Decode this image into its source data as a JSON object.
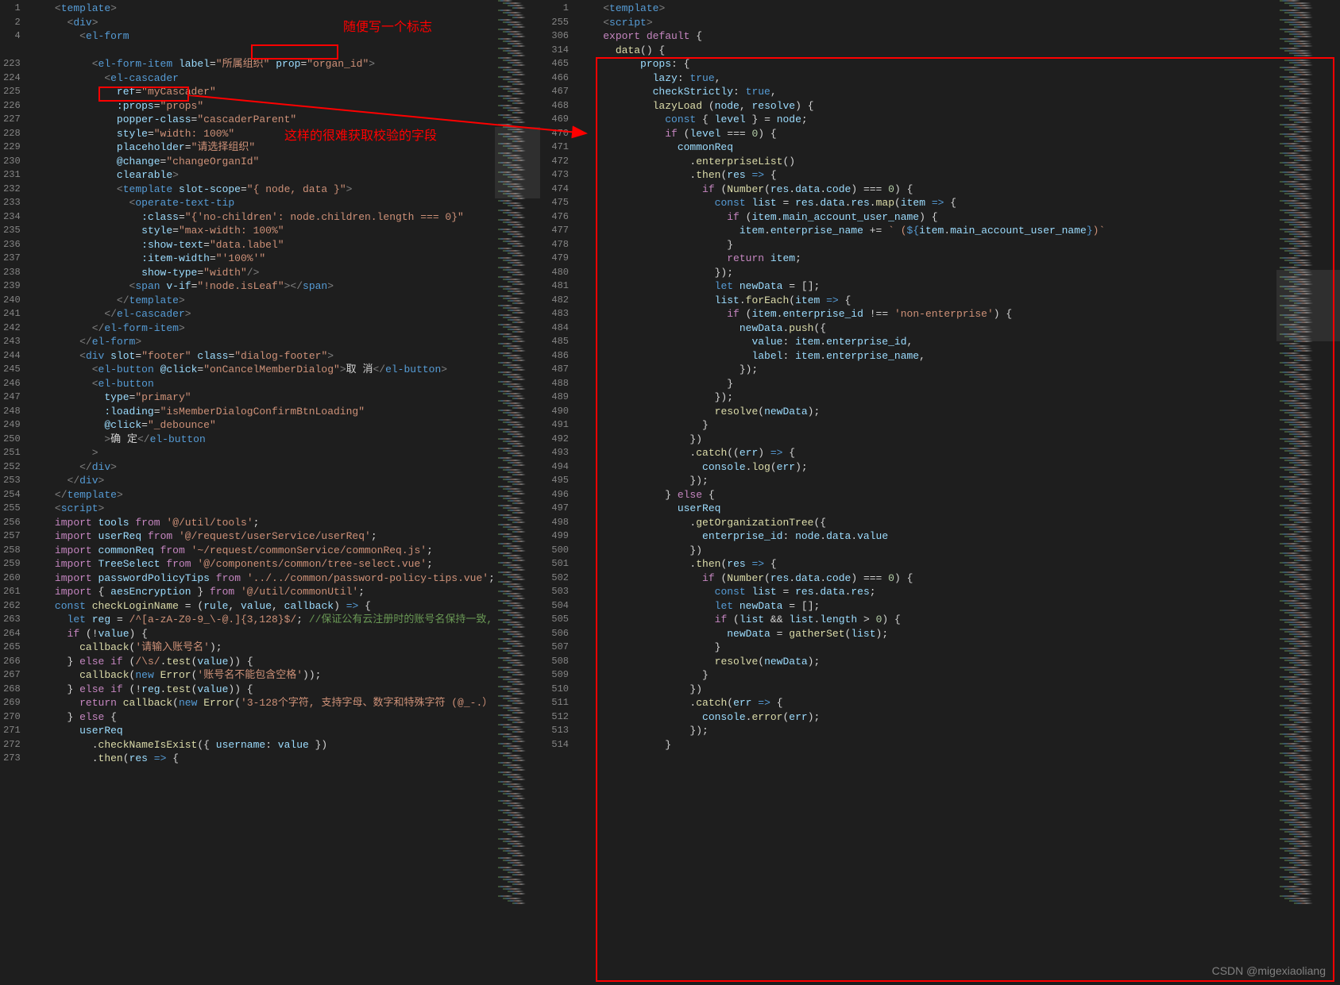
{
  "watermark": "CSDN @migexiaoliang",
  "annotations": {
    "text1": "随便写一个标志",
    "text2": "这样的很难获取校验的字段"
  },
  "left": {
    "lines": [
      {
        "n": "1",
        "html": "<span class='t-punc'>&lt;</span><span class='t-tag'>template</span><span class='t-punc'>&gt;</span>",
        "ind": 2
      },
      {
        "n": "2",
        "html": "<span class='t-punc'>&lt;</span><span class='t-tag'>div</span><span class='t-punc'>&gt;</span>",
        "ind": 3
      },
      {
        "n": "4",
        "html": "<span class='t-punc'>&lt;</span><span class='t-tag'>el-form</span>",
        "ind": 4
      },
      {
        "n": "",
        "html": "",
        "ind": 0
      },
      {
        "n": "223",
        "html": "<span class='t-punc'>&lt;</span><span class='t-tag'>el-form-item</span> <span class='t-attr'>label</span>=<span class='t-str'>\"所属组织\"</span> <span class='t-attr'>prop</span>=<span class='t-str'>\"organ_id\"</span><span class='t-punc'>&gt;</span>",
        "ind": 5
      },
      {
        "n": "224",
        "html": "<span class='t-punc'>&lt;</span><span class='t-tag'>el-cascader</span>",
        "ind": 6
      },
      {
        "n": "225",
        "html": "<span class='t-attr'>ref</span>=<span class='t-str'>\"myCascader\"</span>",
        "ind": 7
      },
      {
        "n": "226",
        "html": "<span class='t-attr'>:props</span>=<span class='t-str'>\"props\"</span>",
        "ind": 7
      },
      {
        "n": "227",
        "html": "<span class='t-attr'>popper-class</span>=<span class='t-str'>\"cascaderParent\"</span>",
        "ind": 7
      },
      {
        "n": "228",
        "html": "<span class='t-attr'>style</span>=<span class='t-str'>\"width: 100%\"</span>",
        "ind": 7
      },
      {
        "n": "229",
        "html": "<span class='t-attr'>placeholder</span>=<span class='t-str'>\"请选择组织\"</span>",
        "ind": 7
      },
      {
        "n": "230",
        "html": "<span class='t-attr'>@change</span>=<span class='t-str'>\"changeOrganId\"</span>",
        "ind": 7
      },
      {
        "n": "231",
        "html": "<span class='t-attr'>clearable</span><span class='t-punc'>&gt;</span>",
        "ind": 7
      },
      {
        "n": "232",
        "html": "<span class='t-punc'>&lt;</span><span class='t-tag'>template</span> <span class='t-attr'>slot-scope</span>=<span class='t-str'>\"{ node, data }\"</span><span class='t-punc'>&gt;</span>",
        "ind": 7
      },
      {
        "n": "233",
        "html": "<span class='t-punc'>&lt;</span><span class='t-tag'>operate-text-tip</span>",
        "ind": 8
      },
      {
        "n": "234",
        "html": "<span class='t-attr'>:class</span>=<span class='t-str'>\"{'no-children': node.children.length === 0}\"</span>",
        "ind": 9
      },
      {
        "n": "235",
        "html": "<span class='t-attr'>style</span>=<span class='t-str'>\"max-width: 100%\"</span>",
        "ind": 9
      },
      {
        "n": "236",
        "html": "<span class='t-attr'>:show-text</span>=<span class='t-str'>\"data.label\"</span>",
        "ind": 9
      },
      {
        "n": "237",
        "html": "<span class='t-attr'>:item-width</span>=<span class='t-str'>\"'100%'\"</span>",
        "ind": 9
      },
      {
        "n": "238",
        "html": "<span class='t-attr'>show-type</span>=<span class='t-str'>\"width\"</span><span class='t-punc'>/&gt;</span>",
        "ind": 9
      },
      {
        "n": "239",
        "html": "<span class='t-punc'>&lt;</span><span class='t-tag'>span</span> <span class='t-attr'>v-if</span>=<span class='t-str'>\"!node.isLeaf\"</span><span class='t-punc'>&gt;&lt;/</span><span class='t-tag'>span</span><span class='t-punc'>&gt;</span>",
        "ind": 8
      },
      {
        "n": "240",
        "html": "<span class='t-punc'>&lt;/</span><span class='t-tag'>template</span><span class='t-punc'>&gt;</span>",
        "ind": 7
      },
      {
        "n": "241",
        "html": "<span class='t-punc'>&lt;/</span><span class='t-tag'>el-cascader</span><span class='t-punc'>&gt;</span>",
        "ind": 6
      },
      {
        "n": "242",
        "html": "<span class='t-punc'>&lt;/</span><span class='t-tag'>el-form-item</span><span class='t-punc'>&gt;</span>",
        "ind": 5
      },
      {
        "n": "243",
        "html": "<span class='t-punc'>&lt;/</span><span class='t-tag'>el-form</span><span class='t-punc'>&gt;</span>",
        "ind": 4
      },
      {
        "n": "244",
        "html": "<span class='t-punc'>&lt;</span><span class='t-tag'>div</span> <span class='t-attr'>slot</span>=<span class='t-str'>\"footer\"</span> <span class='t-attr'>class</span>=<span class='t-str'>\"dialog-footer\"</span><span class='t-punc'>&gt;</span>",
        "ind": 4
      },
      {
        "n": "245",
        "html": "<span class='t-punc'>&lt;</span><span class='t-tag'>el-button</span> <span class='t-attr'>@click</span>=<span class='t-str'>\"onCancelMemberDialog\"</span><span class='t-punc'>&gt;</span><span class='t-txt'>取 消</span><span class='t-punc'>&lt;/</span><span class='t-tag'>el-button</span><span class='t-punc'>&gt;</span>",
        "ind": 5
      },
      {
        "n": "246",
        "html": "<span class='t-punc'>&lt;</span><span class='t-tag'>el-button</span>",
        "ind": 5
      },
      {
        "n": "247",
        "html": "<span class='t-attr'>type</span>=<span class='t-str'>\"primary\"</span>",
        "ind": 6
      },
      {
        "n": "248",
        "html": "<span class='t-attr'>:loading</span>=<span class='t-str'>\"isMemberDialogConfirmBtnLoading\"</span>",
        "ind": 6
      },
      {
        "n": "249",
        "html": "<span class='t-attr'>@click</span>=<span class='t-str'>\"_debounce\"</span>",
        "ind": 6
      },
      {
        "n": "250",
        "html": "<span class='t-punc'>&gt;</span><span class='t-txt'>确 定</span><span class='t-punc'>&lt;/</span><span class='t-tag'>el-button</span>",
        "ind": 6
      },
      {
        "n": "251",
        "html": "<span class='t-punc'>&gt;</span>",
        "ind": 5
      },
      {
        "n": "252",
        "html": "<span class='t-punc'>&lt;/</span><span class='t-tag'>div</span><span class='t-punc'>&gt;</span>",
        "ind": 4
      },
      {
        "n": "253",
        "html": "<span class='t-punc'>&lt;/</span><span class='t-tag'>div</span><span class='t-punc'>&gt;</span>",
        "ind": 3
      },
      {
        "n": "254",
        "html": "<span class='t-punc'>&lt;/</span><span class='t-tag'>template</span><span class='t-punc'>&gt;</span>",
        "ind": 2
      },
      {
        "n": "255",
        "html": "<span class='t-punc'>&lt;</span><span class='t-tag'>script</span><span class='t-punc'>&gt;</span>",
        "ind": 2
      },
      {
        "n": "256",
        "html": "<span class='t-kw2'>import</span> <span class='t-var'>tools</span> <span class='t-kw2'>from</span> <span class='t-str'>'@/util/tools'</span>;",
        "ind": 2
      },
      {
        "n": "257",
        "html": "<span class='t-kw2'>import</span> <span class='t-var'>userReq</span> <span class='t-kw2'>from</span> <span class='t-str'>'@/request/userService/userReq'</span>;",
        "ind": 2
      },
      {
        "n": "258",
        "html": "<span class='t-kw2'>import</span> <span class='t-var'>commonReq</span> <span class='t-kw2'>from</span> <span class='t-str'>'~/request/commonService/commonReq.js'</span>;",
        "ind": 2
      },
      {
        "n": "259",
        "html": "<span class='t-kw2'>import</span> <span class='t-var'>TreeSelect</span> <span class='t-kw2'>from</span> <span class='t-str'>'@/components/common/tree-select.vue'</span>;",
        "ind": 2
      },
      {
        "n": "260",
        "html": "<span class='t-kw2'>import</span> <span class='t-var'>passwordPolicyTips</span> <span class='t-kw2'>from</span> <span class='t-str'>'../../common/password-policy-tips.vue'</span>;",
        "ind": 2
      },
      {
        "n": "261",
        "html": "<span class='t-kw2'>import</span> { <span class='t-var'>aesEncryption</span> } <span class='t-kw2'>from</span> <span class='t-str'>'@/util/commonUtil'</span>;",
        "ind": 2
      },
      {
        "n": "262",
        "html": "<span class='t-kw'>const</span> <span class='t-fn'>checkLoginName</span> <span class='t-op'>=</span> (<span class='t-var'>rule</span>, <span class='t-var'>value</span>, <span class='t-var'>callback</span>) <span class='t-kw'>=&gt;</span> {",
        "ind": 2
      },
      {
        "n": "263",
        "html": "<span class='t-kw'>let</span> <span class='t-var'>reg</span> <span class='t-op'>=</span> <span class='t-str'>/^[a-zA-Z0-9_\\-@.]{3,128}$/</span>; <span class='t-comm'>//保证公有云注册时的账号名保持一致,</span>",
        "ind": 3
      },
      {
        "n": "264",
        "html": "<span class='t-kw2'>if</span> (!<span class='t-var'>value</span>) {",
        "ind": 3
      },
      {
        "n": "265",
        "html": "<span class='t-fn'>callback</span>(<span class='t-str'>'请输入账号名'</span>);",
        "ind": 4
      },
      {
        "n": "266",
        "html": "} <span class='t-kw2'>else if</span> (<span class='t-str'>/\\s/</span>.<span class='t-fn'>test</span>(<span class='t-var'>value</span>)) {",
        "ind": 3
      },
      {
        "n": "267",
        "html": "<span class='t-fn'>callback</span>(<span class='t-kw'>new</span> <span class='t-fn'>Error</span>(<span class='t-str'>'账号名不能包含空格'</span>));",
        "ind": 4
      },
      {
        "n": "268",
        "html": "} <span class='t-kw2'>else if</span> (!<span class='t-var'>reg</span>.<span class='t-fn'>test</span>(<span class='t-var'>value</span>)) {",
        "ind": 3
      },
      {
        "n": "269",
        "html": "<span class='t-kw2'>return</span> <span class='t-fn'>callback</span>(<span class='t-kw'>new</span> <span class='t-fn'>Error</span>(<span class='t-str'>'3-128个字符, 支持字母、数字和特殊字符 (@_-.）</span>",
        "ind": 4
      },
      {
        "n": "270",
        "html": "} <span class='t-kw2'>else</span> {",
        "ind": 3
      },
      {
        "n": "271",
        "html": "<span class='t-var'>userReq</span>",
        "ind": 4
      },
      {
        "n": "272",
        "html": ".<span class='t-fn'>checkNameIsExist</span>({ <span class='t-var'>username</span>: <span class='t-var'>value</span> })",
        "ind": 5
      },
      {
        "n": "273",
        "html": ".<span class='t-fn'>then</span>(<span class='t-var'>res</span> <span class='t-kw'>=&gt;</span> {",
        "ind": 5
      }
    ]
  },
  "right": {
    "lines": [
      {
        "n": "1",
        "html": "<span class='t-punc'>&lt;</span><span class='t-tag'>template</span><span class='t-punc'>&gt;</span>",
        "ind": 2
      },
      {
        "n": "255",
        "html": "<span class='t-punc'>&lt;</span><span class='t-tag'>script</span><span class='t-punc'>&gt;</span>",
        "ind": 2
      },
      {
        "n": "306",
        "html": "<span class='t-kw2'>export</span> <span class='t-kw2'>default</span> {",
        "ind": 2
      },
      {
        "n": "314",
        "html": "<span class='t-fn'>data</span>() {",
        "ind": 3
      },
      {
        "n": "465",
        "html": "<span class='t-var'>props</span>: {",
        "ind": 5
      },
      {
        "n": "466",
        "html": "<span class='t-var'>lazy</span>: <span class='t-kw'>true</span>,",
        "ind": 6
      },
      {
        "n": "467",
        "html": "<span class='t-var'>checkStrictly</span>: <span class='t-kw'>true</span>,",
        "ind": 6
      },
      {
        "n": "468",
        "html": "<span class='t-fn'>lazyLoad</span> (<span class='t-var'>node</span>, <span class='t-var'>resolve</span>) {",
        "ind": 6
      },
      {
        "n": "469",
        "html": "<span class='t-kw'>const</span> { <span class='t-var'>level</span> } <span class='t-op'>=</span> <span class='t-var'>node</span>;",
        "ind": 7
      },
      {
        "n": "470",
        "html": "<span class='t-kw2'>if</span> (<span class='t-var'>level</span> <span class='t-op'>===</span> <span class='t-num'>0</span>) {",
        "ind": 7
      },
      {
        "n": "471",
        "html": "<span class='t-var'>commonReq</span>",
        "ind": 8
      },
      {
        "n": "472",
        "html": ".<span class='t-fn'>enterpriseList</span>()",
        "ind": 9
      },
      {
        "n": "473",
        "html": ".<span class='t-fn'>then</span>(<span class='t-var'>res</span> <span class='t-kw'>=&gt;</span> {",
        "ind": 9
      },
      {
        "n": "474",
        "html": "<span class='t-kw2'>if</span> (<span class='t-fn'>Number</span>(<span class='t-var'>res</span>.<span class='t-var'>data</span>.<span class='t-var'>code</span>) <span class='t-op'>===</span> <span class='t-num'>0</span>) {",
        "ind": 10
      },
      {
        "n": "475",
        "html": "<span class='t-kw'>const</span> <span class='t-var'>list</span> <span class='t-op'>=</span> <span class='t-var'>res</span>.<span class='t-var'>data</span>.<span class='t-var'>res</span>.<span class='t-fn'>map</span>(<span class='t-var'>item</span> <span class='t-kw'>=&gt;</span> {",
        "ind": 11
      },
      {
        "n": "476",
        "html": "<span class='t-kw2'>if</span> (<span class='t-var'>item</span>.<span class='t-var'>main_account_user_name</span>) {",
        "ind": 12
      },
      {
        "n": "477",
        "html": "<span class='t-var'>item</span>.<span class='t-var'>enterprise_name</span> <span class='t-op'>+=</span> <span class='t-str'>` (</span><span class='t-kw'>${</span><span class='t-var'>item</span>.<span class='t-var'>main_account_user_name</span><span class='t-kw'>}</span><span class='t-str'>)`</span>",
        "ind": 13
      },
      {
        "n": "478",
        "html": "}",
        "ind": 12
      },
      {
        "n": "479",
        "html": "<span class='t-kw2'>return</span> <span class='t-var'>item</span>;",
        "ind": 12
      },
      {
        "n": "480",
        "html": "});",
        "ind": 11
      },
      {
        "n": "481",
        "html": "<span class='t-kw'>let</span> <span class='t-var'>newData</span> <span class='t-op'>=</span> [];",
        "ind": 11
      },
      {
        "n": "482",
        "html": "<span class='t-var'>list</span>.<span class='t-fn'>forEach</span>(<span class='t-var'>item</span> <span class='t-kw'>=&gt;</span> {",
        "ind": 11
      },
      {
        "n": "483",
        "html": "<span class='t-kw2'>if</span> (<span class='t-var'>item</span>.<span class='t-var'>enterprise_id</span> <span class='t-op'>!==</span> <span class='t-str'>'non-enterprise'</span>) {",
        "ind": 12
      },
      {
        "n": "484",
        "html": "<span class='t-var'>newData</span>.<span class='t-fn'>push</span>({",
        "ind": 13
      },
      {
        "n": "485",
        "html": "<span class='t-var'>value</span>: <span class='t-var'>item</span>.<span class='t-var'>enterprise_id</span>,",
        "ind": 14
      },
      {
        "n": "486",
        "html": "<span class='t-var'>label</span>: <span class='t-var'>item</span>.<span class='t-var'>enterprise_name</span>,",
        "ind": 14
      },
      {
        "n": "487",
        "html": "});",
        "ind": 13
      },
      {
        "n": "488",
        "html": "}",
        "ind": 12
      },
      {
        "n": "489",
        "html": "});",
        "ind": 11
      },
      {
        "n": "490",
        "html": "<span class='t-fn'>resolve</span>(<span class='t-var'>newData</span>);",
        "ind": 11
      },
      {
        "n": "491",
        "html": "}",
        "ind": 10
      },
      {
        "n": "492",
        "html": "})",
        "ind": 9
      },
      {
        "n": "493",
        "html": ".<span class='t-fn'>catch</span>((<span class='t-var'>err</span>) <span class='t-kw'>=&gt;</span> {",
        "ind": 9
      },
      {
        "n": "494",
        "html": "<span class='t-var'>console</span>.<span class='t-fn'>log</span>(<span class='t-var'>err</span>);",
        "ind": 10
      },
      {
        "n": "495",
        "html": "});",
        "ind": 9
      },
      {
        "n": "496",
        "html": "} <span class='t-kw2'>else</span> {",
        "ind": 7
      },
      {
        "n": "497",
        "html": "<span class='t-var'>userReq</span>",
        "ind": 8
      },
      {
        "n": "498",
        "html": ".<span class='t-fn'>getOrganizationTree</span>({",
        "ind": 9
      },
      {
        "n": "499",
        "html": "<span class='t-var'>enterprise_id</span>: <span class='t-var'>node</span>.<span class='t-var'>data</span>.<span class='t-var'>value</span>",
        "ind": 10
      },
      {
        "n": "500",
        "html": "})",
        "ind": 9
      },
      {
        "n": "501",
        "html": ".<span class='t-fn'>then</span>(<span class='t-var'>res</span> <span class='t-kw'>=&gt;</span> {",
        "ind": 9
      },
      {
        "n": "502",
        "html": "<span class='t-kw2'>if</span> (<span class='t-fn'>Number</span>(<span class='t-var'>res</span>.<span class='t-var'>data</span>.<span class='t-var'>code</span>) <span class='t-op'>===</span> <span class='t-num'>0</span>) {",
        "ind": 10
      },
      {
        "n": "503",
        "html": "<span class='t-kw'>const</span> <span class='t-var'>list</span> <span class='t-op'>=</span> <span class='t-var'>res</span>.<span class='t-var'>data</span>.<span class='t-var'>res</span>;",
        "ind": 11
      },
      {
        "n": "504",
        "html": "<span class='t-kw'>let</span> <span class='t-var'>newData</span> <span class='t-op'>=</span> [];",
        "ind": 11
      },
      {
        "n": "505",
        "html": "<span class='t-kw2'>if</span> (<span class='t-var'>list</span> <span class='t-op'>&amp;&amp;</span> <span class='t-var'>list</span>.<span class='t-var'>length</span> <span class='t-op'>&gt;</span> <span class='t-num'>0</span>) {",
        "ind": 11
      },
      {
        "n": "506",
        "html": "<span class='t-var'>newData</span> <span class='t-op'>=</span> <span class='t-fn'>gatherSet</span>(<span class='t-var'>list</span>);",
        "ind": 12
      },
      {
        "n": "507",
        "html": "}",
        "ind": 11
      },
      {
        "n": "508",
        "html": "<span class='t-fn'>resolve</span>(<span class='t-var'>newData</span>);",
        "ind": 11
      },
      {
        "n": "509",
        "html": "}",
        "ind": 10
      },
      {
        "n": "510",
        "html": "})",
        "ind": 9
      },
      {
        "n": "511",
        "html": ".<span class='t-fn'>catch</span>(<span class='t-var'>err</span> <span class='t-kw'>=&gt;</span> {",
        "ind": 9
      },
      {
        "n": "512",
        "html": "<span class='t-var'>console</span>.<span class='t-fn'>error</span>(<span class='t-var'>err</span>);",
        "ind": 10
      },
      {
        "n": "513",
        "html": "});",
        "ind": 9
      },
      {
        "n": "514",
        "html": "}",
        "ind": 7
      }
    ]
  }
}
